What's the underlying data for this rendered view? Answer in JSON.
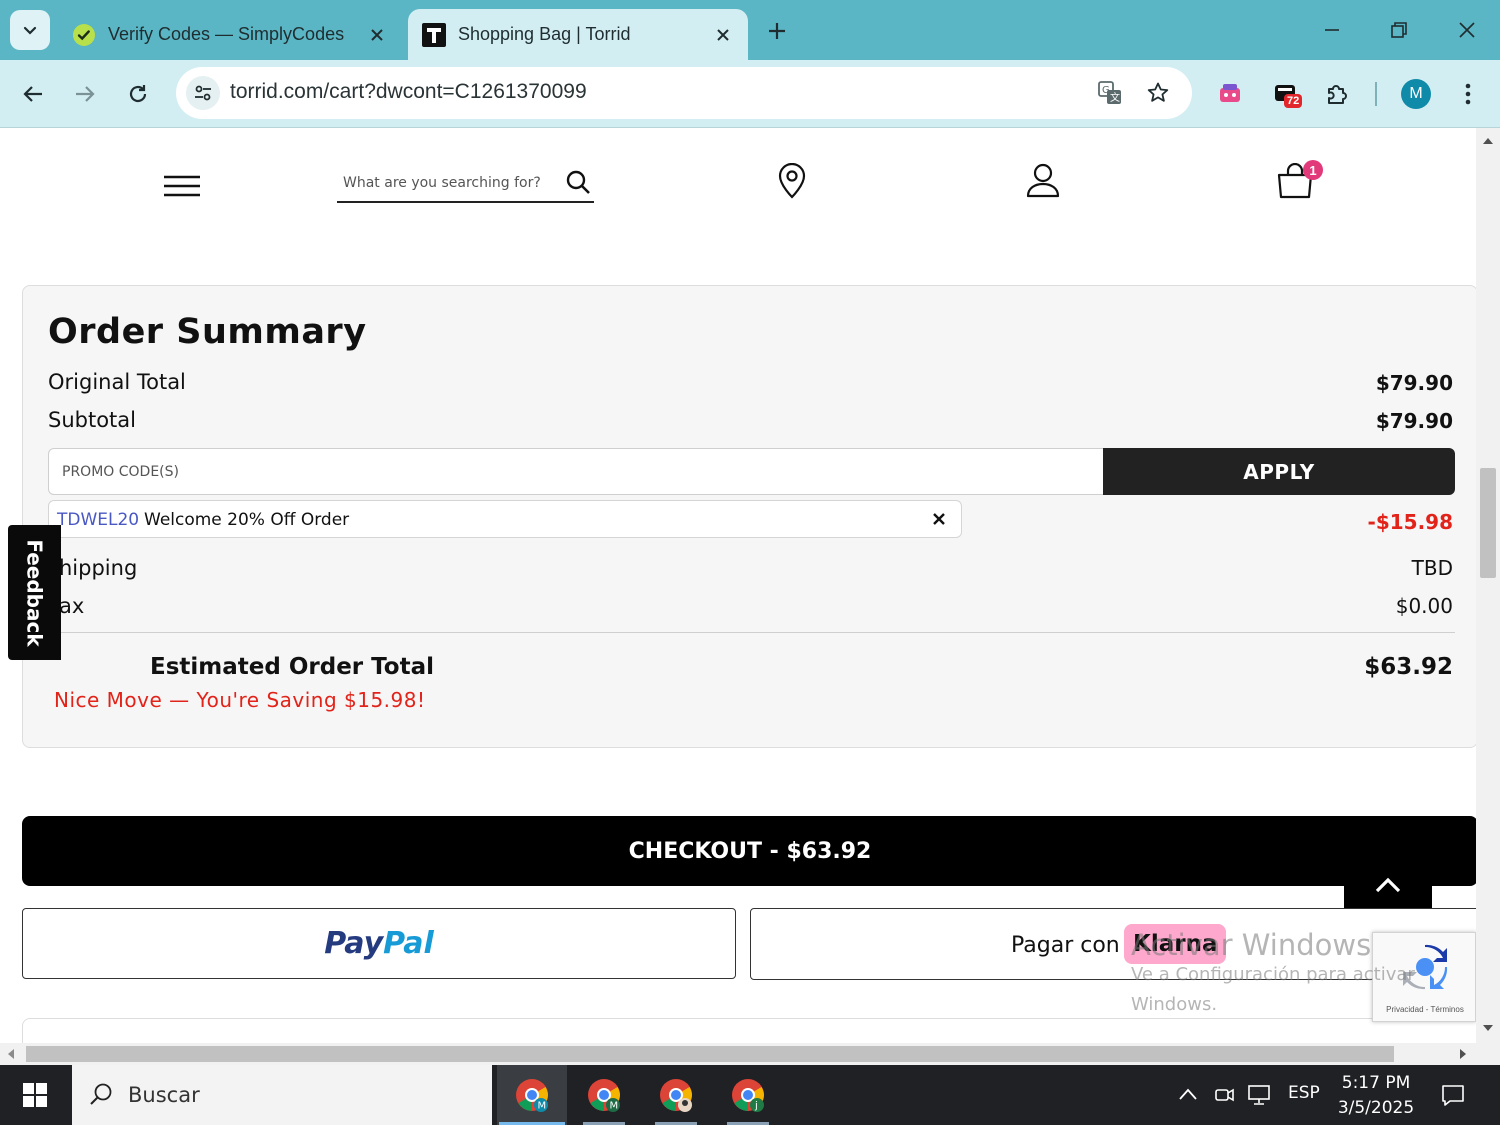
{
  "browser": {
    "tabs": [
      {
        "title": "Verify Codes — SimplyCodes",
        "active": false,
        "favicon": "simplycodes-icon"
      },
      {
        "title": "Shopping Bag | Torrid",
        "active": true,
        "favicon": "torrid-icon"
      }
    ],
    "url": "torrid.com/cart?dwcont=C1261370099",
    "extension_badge": "72",
    "profile_initial": "M"
  },
  "site_header": {
    "search_placeholder": "What are you searching for?",
    "cart_count": "1"
  },
  "order_summary": {
    "title": "Order Summary",
    "original_total_label": "Original Total",
    "original_total_value": "$79.90",
    "subtotal_label": "Subtotal",
    "subtotal_value": "$79.90",
    "promo_placeholder": "PROMO CODE(S)",
    "apply_label": "APPLY",
    "applied_code": "TDWEL20",
    "applied_code_desc": "Welcome 20% Off Order",
    "discount_value": "-$15.98",
    "shipping_label": "hipping",
    "shipping_value": "TBD",
    "tax_label": "ax",
    "tax_value": "$0.00",
    "estimated_total_label": "Estimated Order Total",
    "estimated_total_value": "$63.92",
    "saving_message": "Nice Move — You're Saving $15.98!"
  },
  "feedback_label": "Feedback",
  "checkout_label": "CHECKOUT - $63.92",
  "paypal": {
    "pay": "Pay",
    "pal": "Pal"
  },
  "klarna": {
    "pagar": "Pagar con",
    "brand": "Klarna"
  },
  "recaptcha_terms": "Privacidad - Términos",
  "watermark": {
    "line1": "Activar Windows",
    "line2": "Ve a Configuración para activar",
    "line3": "Windows."
  },
  "taskbar": {
    "search_label": "Buscar",
    "language": "ESP",
    "time": "5:17 PM",
    "date": "3/5/2025",
    "apps": [
      {
        "name": "chrome-icon",
        "profile": "M"
      },
      {
        "name": "chrome-icon",
        "profile": "M"
      },
      {
        "name": "chrome-icon",
        "profile": ""
      },
      {
        "name": "chrome-icon",
        "profile": "j"
      }
    ]
  },
  "colors": {
    "tabbar": "#5ab5c4",
    "toolbar": "#d3eef2",
    "discount_red": "#e2231a",
    "promo_code_blue": "#4a58c4",
    "cart_badge": "#e2397a",
    "klarna_pink": "#ffa8cd"
  }
}
